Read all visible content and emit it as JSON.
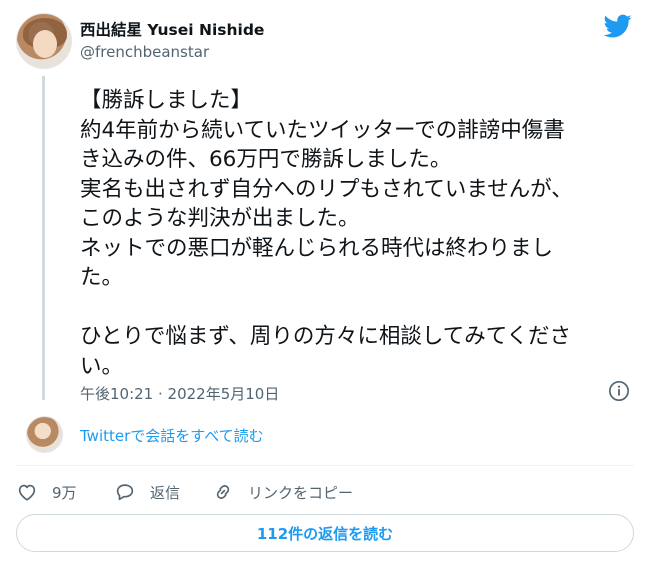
{
  "user": {
    "display_name": "西出結星 Yusei Nishide",
    "handle": "@frenchbeanstar"
  },
  "tweet": {
    "lines": [
      "【勝訴しました】",
      "約4年前から続いていたツイッターでの誹謗中傷書",
      "き込みの件、66万円で勝訴しました。",
      "実名も出されず自分へのリプもされていませんが、",
      "このような判決が出ました。",
      "ネットでの悪口が軽んじられる時代は終わりまし",
      "た。",
      "",
      "ひとりで悩まず、周りの方々に相談してみてくださ",
      "い。"
    ],
    "timestamp": "午後10:21 · 2022年5月10日"
  },
  "conversation": {
    "link_label": "Twitterで会話をすべて読む"
  },
  "actions": {
    "like_count": "9万",
    "reply_label": "返信",
    "copy_link_label": "リンクをコピー"
  },
  "replies_button": {
    "label": "112件の返信を読む"
  },
  "colors": {
    "brand_blue": "#1d9bf0",
    "secondary_text": "#536471",
    "border": "#cfd9de"
  },
  "icons": [
    "twitter-logo-icon",
    "info-icon",
    "heart-icon",
    "reply-bubble-icon",
    "link-icon"
  ]
}
